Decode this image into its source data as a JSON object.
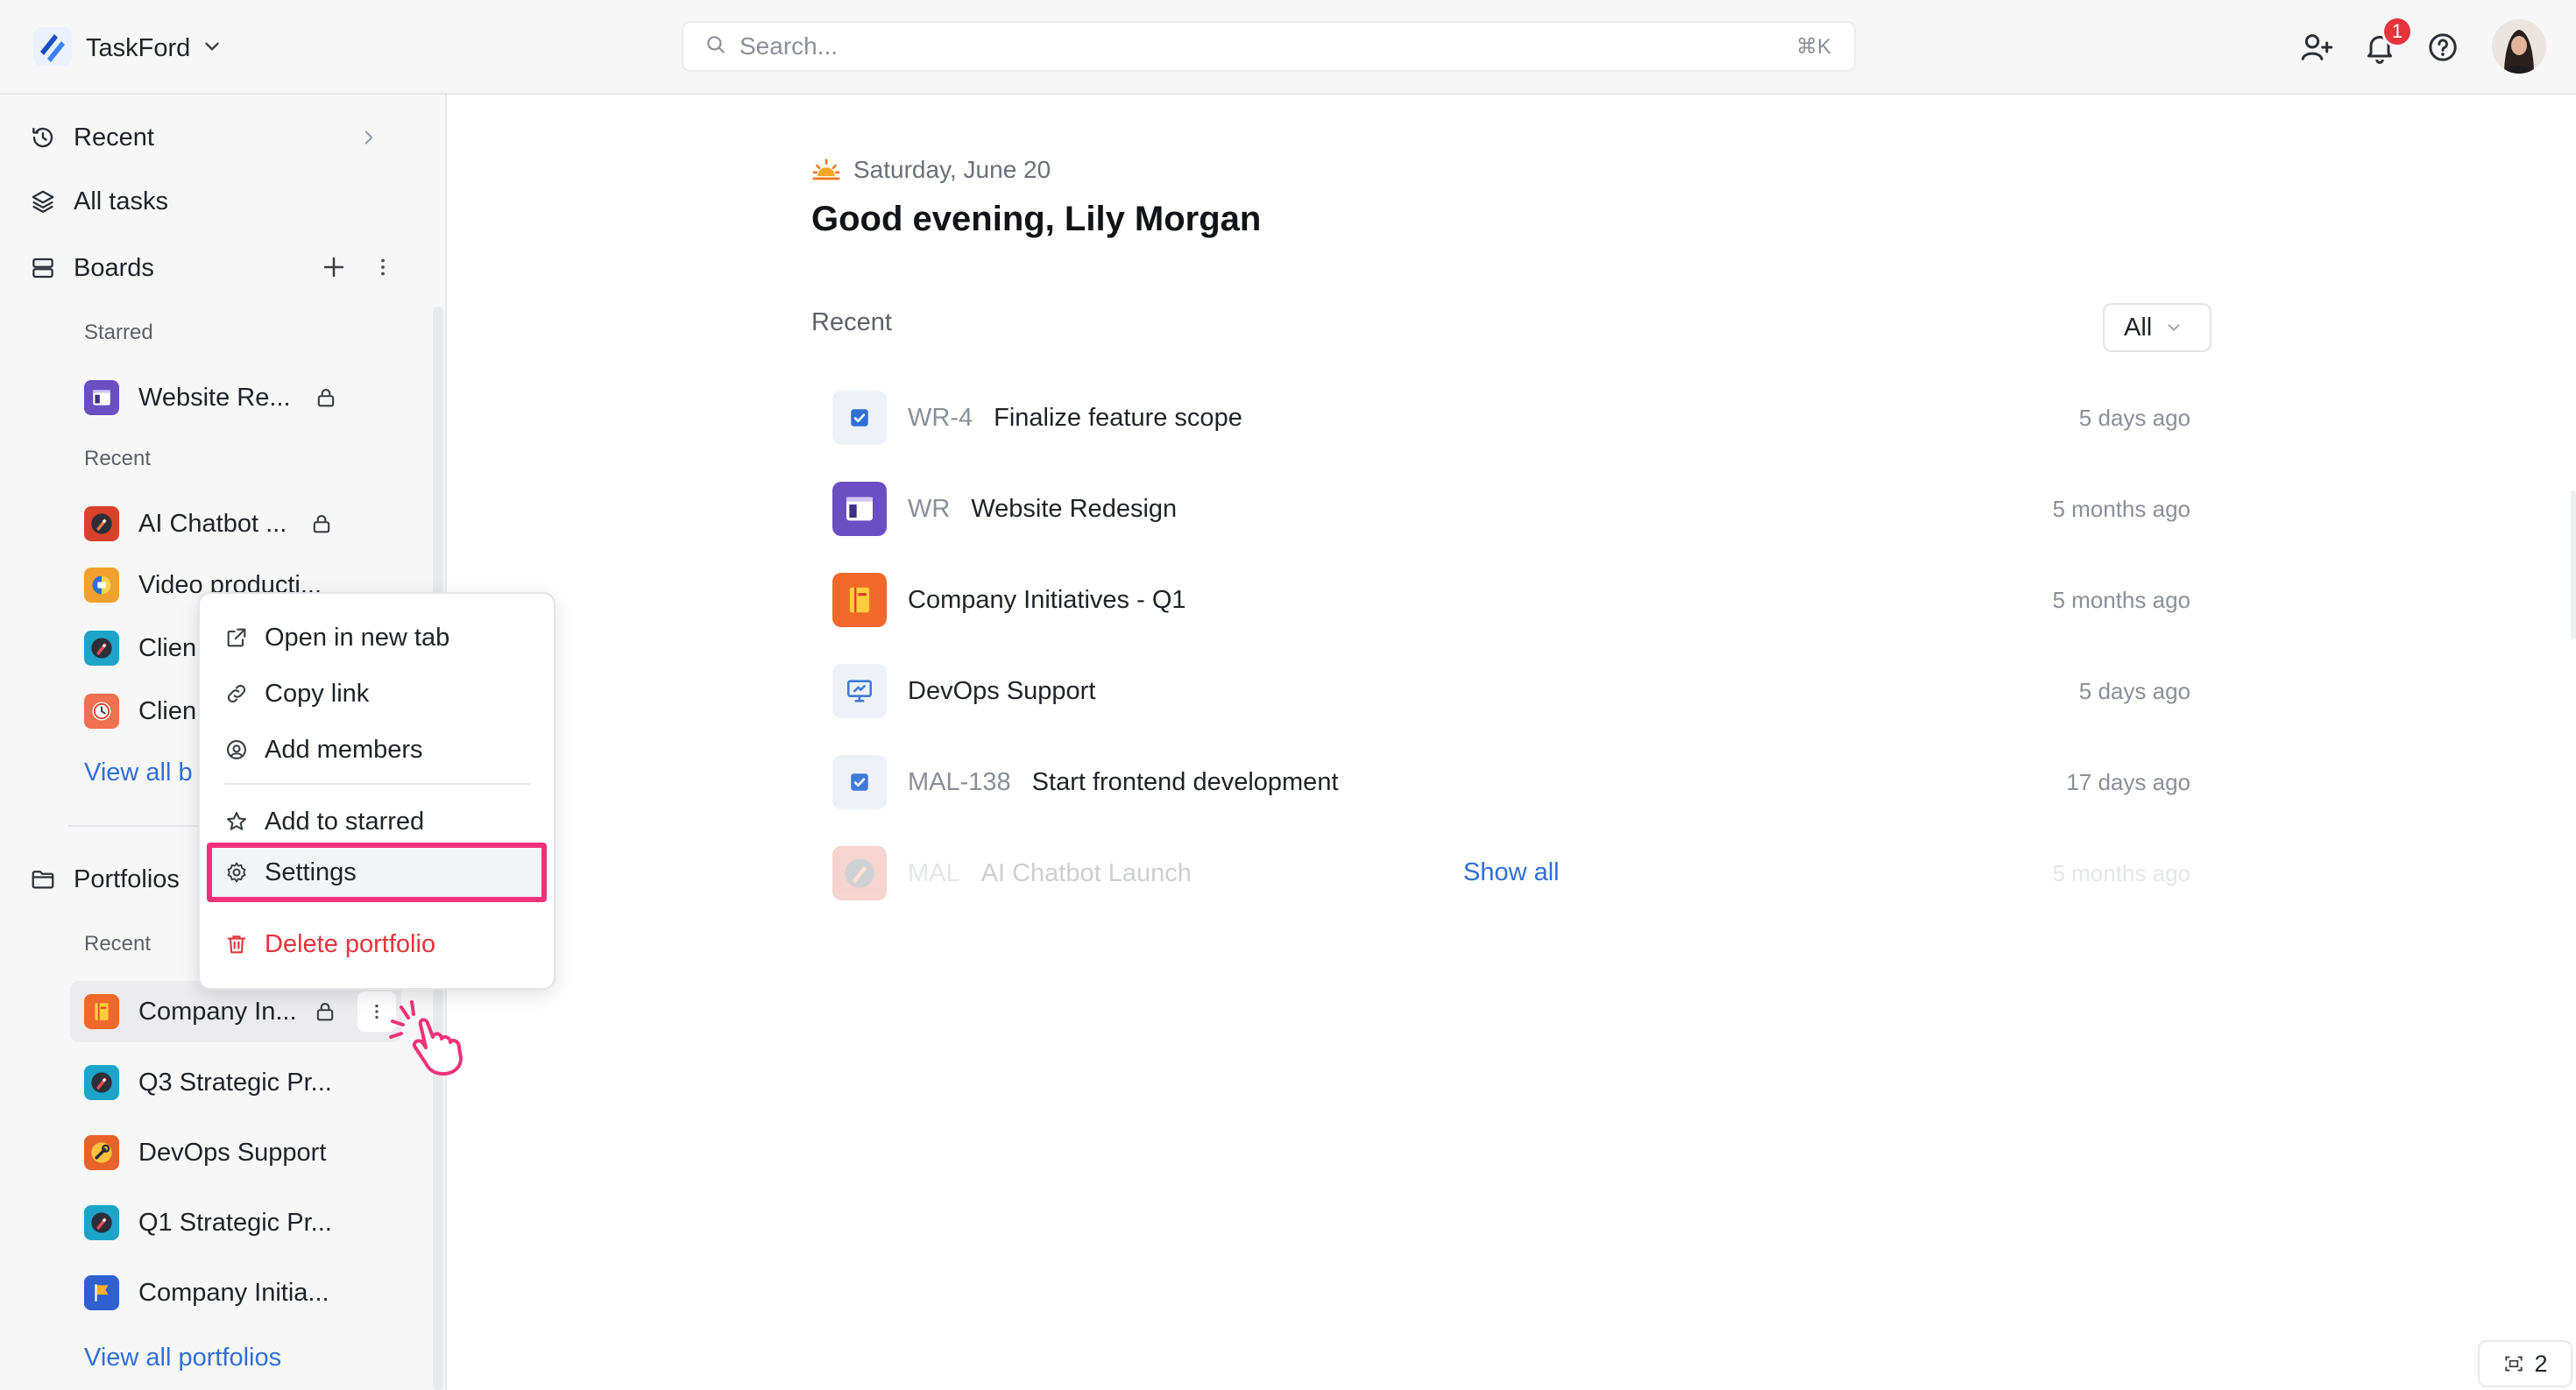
{
  "header": {
    "brand": "TaskFord",
    "search_placeholder": "Search...",
    "search_shortcut": "⌘K",
    "notification_count": "1"
  },
  "sidebar": {
    "nav": {
      "recent": "Recent",
      "all_tasks": "All tasks",
      "boards": "Boards",
      "portfolios": "Portfolios"
    },
    "boards": {
      "starred_label": "Starred",
      "starred": [
        {
          "label": "Website Re..."
        }
      ],
      "recent_label": "Recent",
      "recent": [
        {
          "label": "AI Chatbot ..."
        },
        {
          "label": "Video producti..."
        },
        {
          "label": "Clien"
        },
        {
          "label": "Clien"
        }
      ],
      "view_all": "View all b"
    },
    "portfolios": {
      "recent_label": "Recent",
      "items": [
        {
          "label": "Company In..."
        },
        {
          "label": "Q3 Strategic Pr..."
        },
        {
          "label": "DevOps Support"
        },
        {
          "label": "Q1 Strategic Pr..."
        },
        {
          "label": "Company Initia..."
        }
      ],
      "view_all": "View all portfolios"
    }
  },
  "context_menu": {
    "open_new_tab": "Open in new tab",
    "copy_link": "Copy link",
    "add_members": "Add members",
    "add_starred": "Add to starred",
    "settings": "Settings",
    "delete": "Delete portfolio"
  },
  "main": {
    "date": "Saturday, June 20",
    "greeting": "Good evening, Lily Morgan",
    "recent_label": "Recent",
    "filter_value": "All",
    "rows": [
      {
        "code": "WR-4",
        "title": "Finalize feature scope",
        "time": "5 days ago"
      },
      {
        "code": "WR",
        "title": "Website Redesign",
        "time": "5 months ago"
      },
      {
        "code": "",
        "title": "Company Initiatives - Q1",
        "time": "5 months ago"
      },
      {
        "code": "",
        "title": "DevOps Support",
        "time": "5 days ago"
      },
      {
        "code": "MAL-138",
        "title": "Start frontend development",
        "time": "17 days ago"
      },
      {
        "code": "MAL",
        "title": "AI Chatbot Launch",
        "time": "5 months ago"
      }
    ],
    "show_all": "Show all"
  },
  "footer": {
    "pager_count": "2"
  },
  "colors": {
    "accent": "#2f6fd6",
    "danger": "#e5343b",
    "highlight": "#f0317a"
  }
}
